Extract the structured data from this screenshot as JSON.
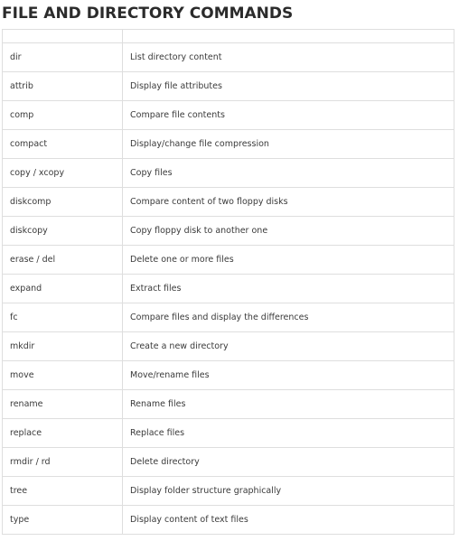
{
  "page": {
    "title": "FILE AND DIRECTORY COMMANDS"
  },
  "table": {
    "header": [
      "",
      ""
    ],
    "rows": [
      {
        "command": "dir",
        "description": "List directory content"
      },
      {
        "command": "attrib",
        "description": "Display file attributes"
      },
      {
        "command": "comp",
        "description": "Compare file contents"
      },
      {
        "command": "compact",
        "description": "Display/change file compression"
      },
      {
        "command": "copy / xcopy",
        "description": "Copy files"
      },
      {
        "command": "diskcomp",
        "description": "Compare content of two floppy disks"
      },
      {
        "command": "diskcopy",
        "description": "Copy floppy disk to another one"
      },
      {
        "command": "erase / del",
        "description": "Delete one or more files"
      },
      {
        "command": "expand",
        "description": "Extract files"
      },
      {
        "command": "fc",
        "description": "Compare files and display the differences"
      },
      {
        "command": "mkdir",
        "description": "Create a new directory"
      },
      {
        "command": "move",
        "description": "Move/rename files"
      },
      {
        "command": "rename",
        "description": "Rename files"
      },
      {
        "command": "replace",
        "description": "Replace files"
      },
      {
        "command": "rmdir / rd",
        "description": "Delete directory"
      },
      {
        "command": "tree",
        "description": "Display folder structure graphically"
      },
      {
        "command": "type",
        "description": "Display content of text files"
      }
    ]
  }
}
